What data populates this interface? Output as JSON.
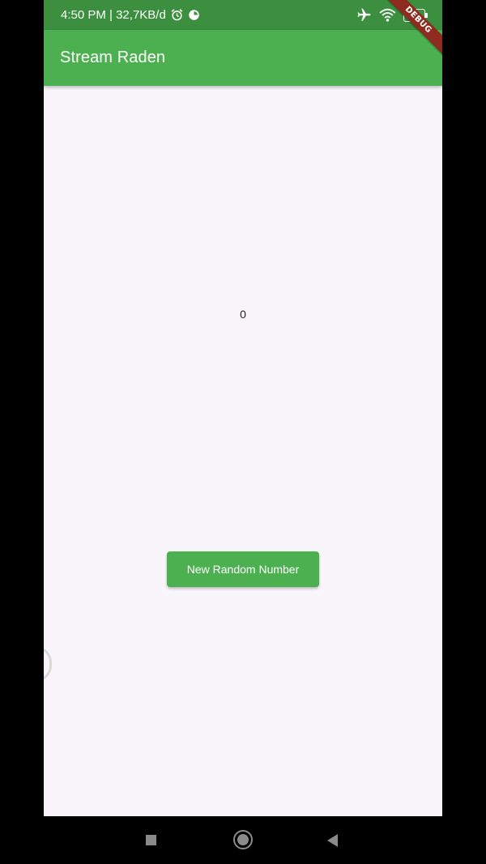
{
  "status_bar": {
    "time_and_data": "4:50 PM | 32,7KB/d",
    "battery_level": "81",
    "icons": [
      "alarm-icon",
      "data-saver-icon",
      "airplane-icon",
      "wifi-icon",
      "battery-icon"
    ]
  },
  "debug_banner": {
    "label": "DEBUG"
  },
  "app_bar": {
    "title": "Stream Raden"
  },
  "main": {
    "number_value": "0",
    "button_label": "New Random Number"
  },
  "nav_bar": {
    "icons": [
      "recents-icon",
      "home-icon",
      "back-icon"
    ]
  },
  "colors": {
    "primary": "#4caf50",
    "status_bar": "#3b8f3f",
    "background": "#f8f6fa",
    "debug_banner": "#8f2a1f"
  }
}
